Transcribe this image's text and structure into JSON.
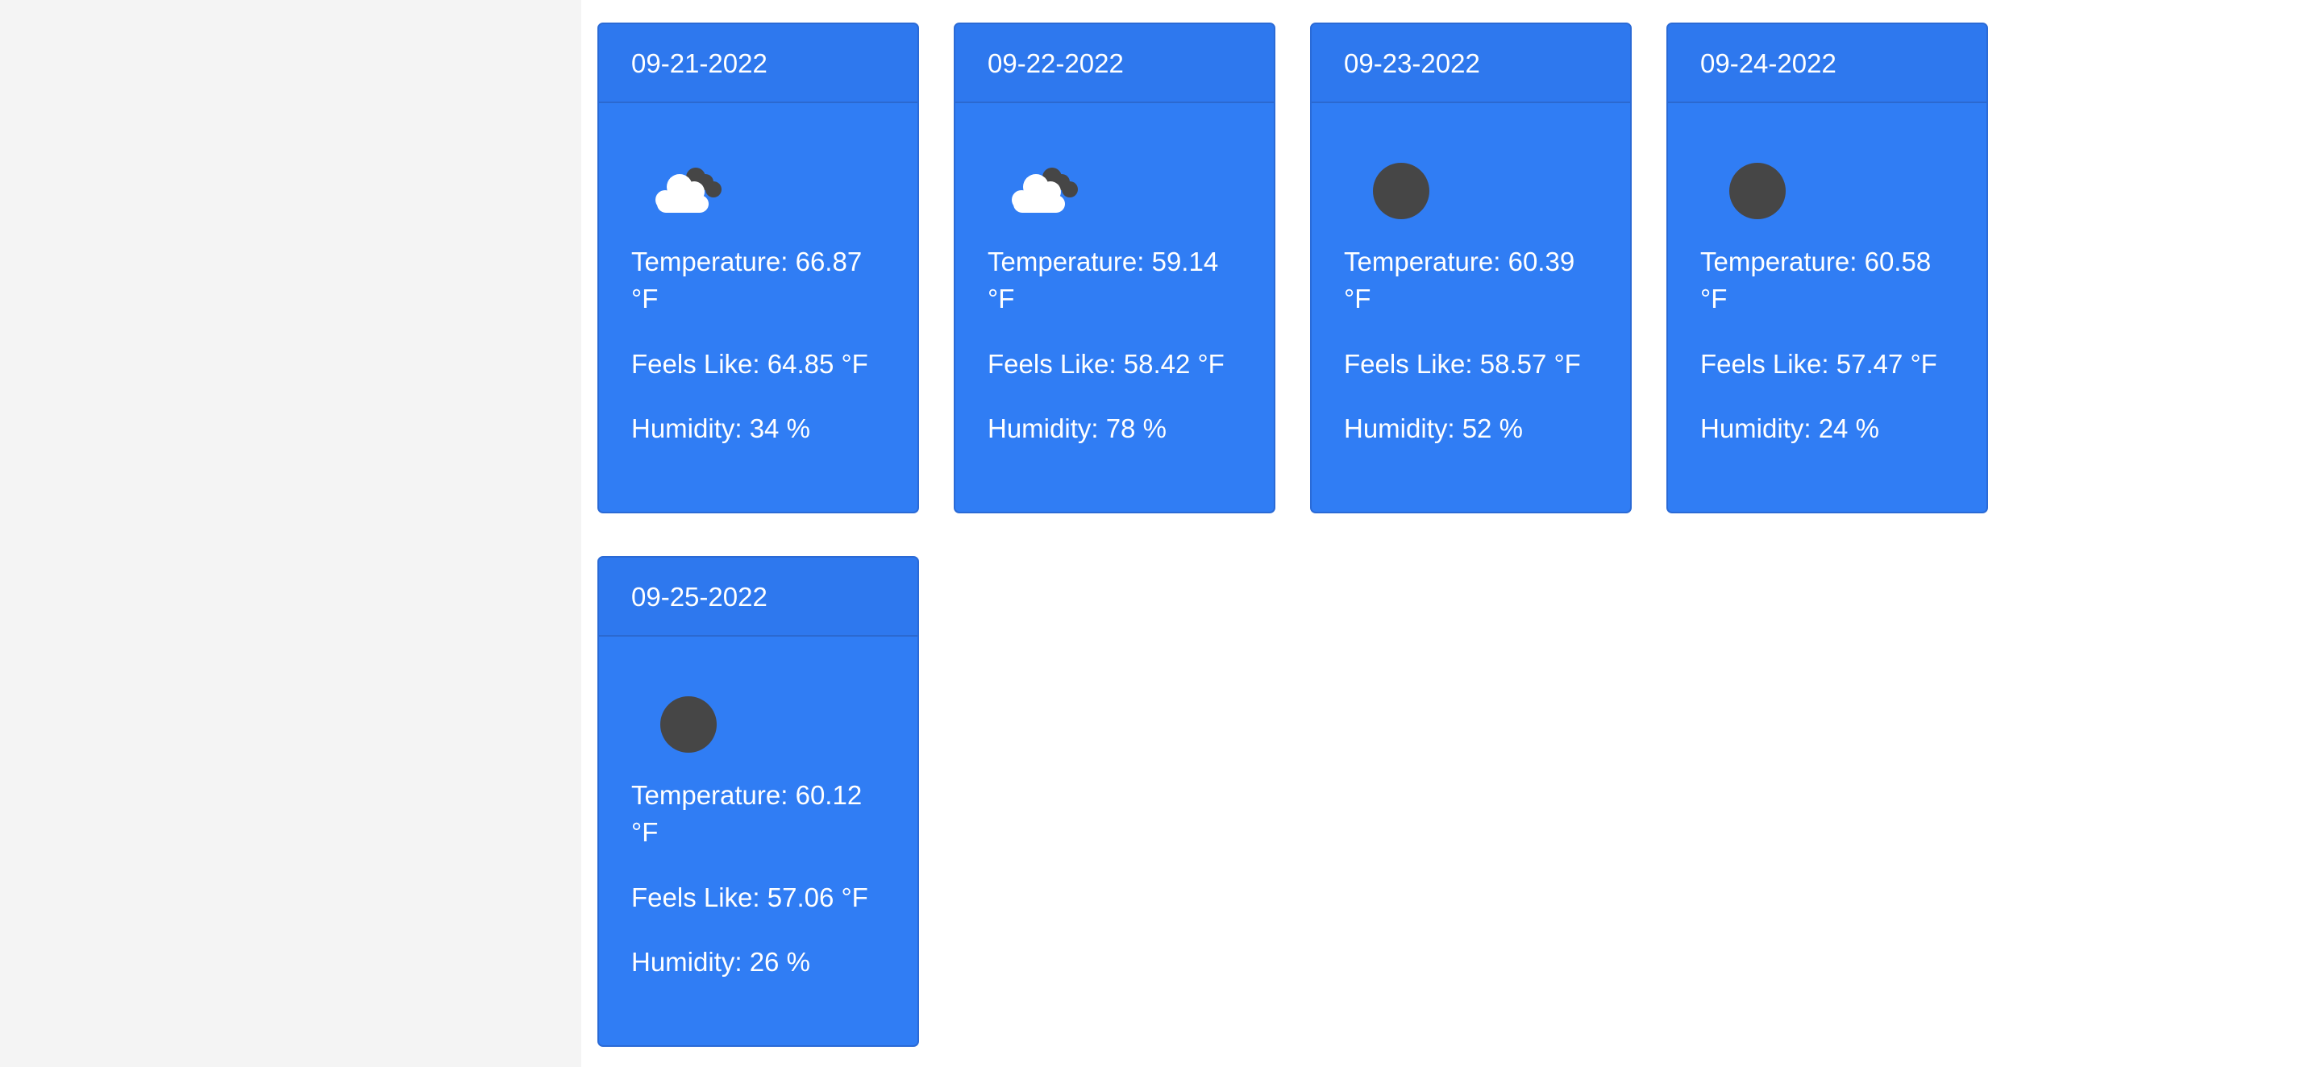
{
  "forecast": [
    {
      "date": "09-21-2022",
      "icon": "cloud-icon",
      "temperature": "Temperature: 66.87 °F",
      "feels_like": "Feels Like: 64.85 °F",
      "humidity": "Humidity: 34 %"
    },
    {
      "date": "09-22-2022",
      "icon": "cloud-icon",
      "temperature": "Temperature: 59.14 °F",
      "feels_like": "Feels Like: 58.42 °F",
      "humidity": "Humidity: 78 %"
    },
    {
      "date": "09-23-2022",
      "icon": "sun-icon",
      "temperature": "Temperature: 60.39 °F",
      "feels_like": "Feels Like: 58.57 °F",
      "humidity": "Humidity: 52 %"
    },
    {
      "date": "09-24-2022",
      "icon": "sun-icon",
      "temperature": "Temperature: 60.58 °F",
      "feels_like": "Feels Like: 57.47 °F",
      "humidity": "Humidity: 24 %"
    },
    {
      "date": "09-25-2022",
      "icon": "sun-icon",
      "temperature": "Temperature: 60.12 °F",
      "feels_like": "Feels Like: 57.06 °F",
      "humidity": "Humidity: 26 %"
    }
  ],
  "colors": {
    "card_bg": "#307df4",
    "card_header_bg": "#2e78ee",
    "page_bg": "#ffffff",
    "sidebar_bg": "#f4f4f4",
    "icon_dark": "#464646"
  }
}
